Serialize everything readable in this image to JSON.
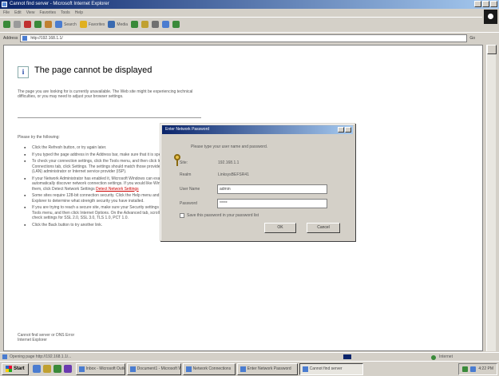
{
  "window": {
    "title": "Cannot find server - Microsoft Internet Explorer",
    "menus": [
      "File",
      "Edit",
      "View",
      "Favorites",
      "Tools",
      "Help"
    ]
  },
  "toolbar": {
    "items": [
      {
        "label": "",
        "icon": "back-icon",
        "color": "#3a8a3a"
      },
      {
        "label": "",
        "icon": "forward-icon",
        "color": "#9a9a9a"
      },
      {
        "label": "",
        "icon": "stop-icon",
        "color": "#c03030"
      },
      {
        "label": "",
        "icon": "refresh-icon",
        "color": "#3a8a3a"
      },
      {
        "label": "",
        "icon": "home-icon",
        "color": "#c08030"
      },
      {
        "label": "Search",
        "icon": "search-icon",
        "color": "#4a7cd0"
      },
      {
        "label": "Favorites",
        "icon": "favorites-icon",
        "color": "#e0b020"
      },
      {
        "label": "Media",
        "icon": "media-icon",
        "color": "#3a6ab0"
      },
      {
        "label": "",
        "icon": "history-icon",
        "color": "#3a8a3a"
      },
      {
        "label": "",
        "icon": "mail-icon",
        "color": "#c0a030"
      },
      {
        "label": "",
        "icon": "print-icon",
        "color": "#707070"
      },
      {
        "label": "",
        "icon": "edit-icon",
        "color": "#4a7cd0"
      },
      {
        "label": "",
        "icon": "messenger-icon",
        "color": "#3a8a3a"
      }
    ]
  },
  "address": {
    "label": "Address",
    "url": "http://192.168.1.1/",
    "go": "Go"
  },
  "page": {
    "info_icon": "i",
    "title": "The page cannot be displayed",
    "intro": "The page you are looking for is currently unavailable. The Web site might be experiencing technical difficulties, or you may need to adjust your browser settings.",
    "try_label": "Please try the following:",
    "bullets": [
      "Click the Refresh button, or try again later.",
      "If you typed the page address in the Address bar, make sure that it is spelled correctly.",
      "To check your connection settings, click the Tools menu, and then click Internet Options. On the Connections tab, click Settings. The settings should match those provided by your local area network (LAN) administrator or Internet service provider (ISP).",
      "If your Network Administrator has enabled it, Microsoft Windows can examine your network and automatically discover network connection settings. If you would like Windows to try and discover them, click Detect Network Settings",
      "Some sites require 128-bit connection security. Click the Help menu and then click About Internet Explorer to determine what strength security you have installed.",
      "If you are trying to reach a secure site, make sure your Security settings can support it. Click the Tools menu, and then click Internet Options. On the Advanced tab, scroll to the Security section and check settings for SSL 2.0, SSL 3.0, TLS 1.0, PCT 1.0.",
      "Click the Back button to try another link."
    ],
    "link_detect": "Detect Network Settings",
    "footer_1": "Cannot find server or DNS Error",
    "footer_2": "Internet Explorer"
  },
  "dialog": {
    "title": "Enter Network Password",
    "prompt": "Please type your user name and password.",
    "site_label": "Site:",
    "site_value": "192.168.1.1",
    "realm_label": "Realm",
    "realm_value": "LinksysBEFSR41",
    "user_label": "User Name",
    "user_value": "admin",
    "password_label": "Password",
    "password_value": "*****",
    "save_label": "Save this password in your password list",
    "ok_label": "OK",
    "cancel_label": "Cancel"
  },
  "status": {
    "text": "Opening page http://192.168.1.1/...",
    "zone": "Internet"
  },
  "taskbar": {
    "start": "Start",
    "quick_launch": [
      {
        "icon": "ie-quicklaunch-icon",
        "color": "#4a7cd0"
      },
      {
        "icon": "outlook-quicklaunch-icon",
        "color": "#c0a030"
      },
      {
        "icon": "desktop-quicklaunch-icon",
        "color": "#3a8a3a"
      },
      {
        "icon": "media-quicklaunch-icon",
        "color": "#6a3ab0"
      }
    ],
    "tasks": [
      {
        "label": "Inbox - Microsoft Outlook",
        "active": false
      },
      {
        "label": "Document1 - Microsoft Word",
        "active": false
      },
      {
        "label": "Network Connections",
        "active": false
      },
      {
        "label": "Enter Network Password",
        "active": false
      },
      {
        "label": "Cannot find server",
        "active": true
      }
    ],
    "clock": "4:22 PM"
  }
}
